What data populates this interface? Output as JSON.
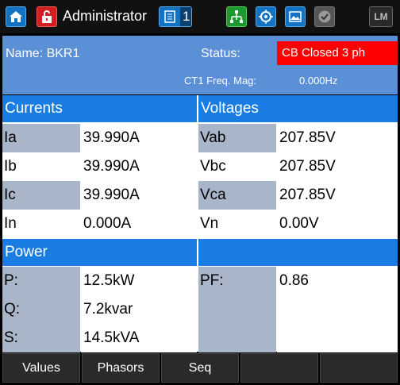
{
  "topbar": {
    "user": "Administrator",
    "doc_count": "1",
    "lm_label": "LM",
    "icons": [
      "home-icon",
      "lock-icon",
      "document-icon",
      "network-icon",
      "target-icon",
      "image-icon",
      "check-icon"
    ]
  },
  "header": {
    "name_label": "Name: BKR1",
    "status_label": "Status:",
    "status_value": "CB Closed 3 ph",
    "ct_label": "CT1 Freq. Mag:",
    "ct_value": "0.000Hz"
  },
  "currents": {
    "title": "Currents",
    "rows": [
      {
        "label": "Ia",
        "value": "39.990A"
      },
      {
        "label": "Ib",
        "value": "39.990A"
      },
      {
        "label": "Ic",
        "value": "39.990A"
      },
      {
        "label": "In",
        "value": "0.000A"
      }
    ]
  },
  "voltages": {
    "title": "Voltages",
    "rows": [
      {
        "label": "Vab",
        "value": "207.85V"
      },
      {
        "label": "Vbc",
        "value": "207.85V"
      },
      {
        "label": "Vca",
        "value": "207.85V"
      },
      {
        "label": "Vn",
        "value": "0.00V"
      }
    ]
  },
  "power": {
    "title": "Power",
    "rows": [
      {
        "label": "P:",
        "value": "12.5kW"
      },
      {
        "label": "Q:",
        "value": "7.2kvar"
      },
      {
        "label": "S:",
        "value": "14.5kVA"
      }
    ],
    "pf_label": "PF:",
    "pf_value": "0.86"
  },
  "tabs": [
    "Values",
    "Phasors",
    "Seq",
    "",
    ""
  ],
  "colors": {
    "accent": "#1a7de4",
    "status_alarm": "#ff0000",
    "header_bg": "#5b8fd6"
  }
}
